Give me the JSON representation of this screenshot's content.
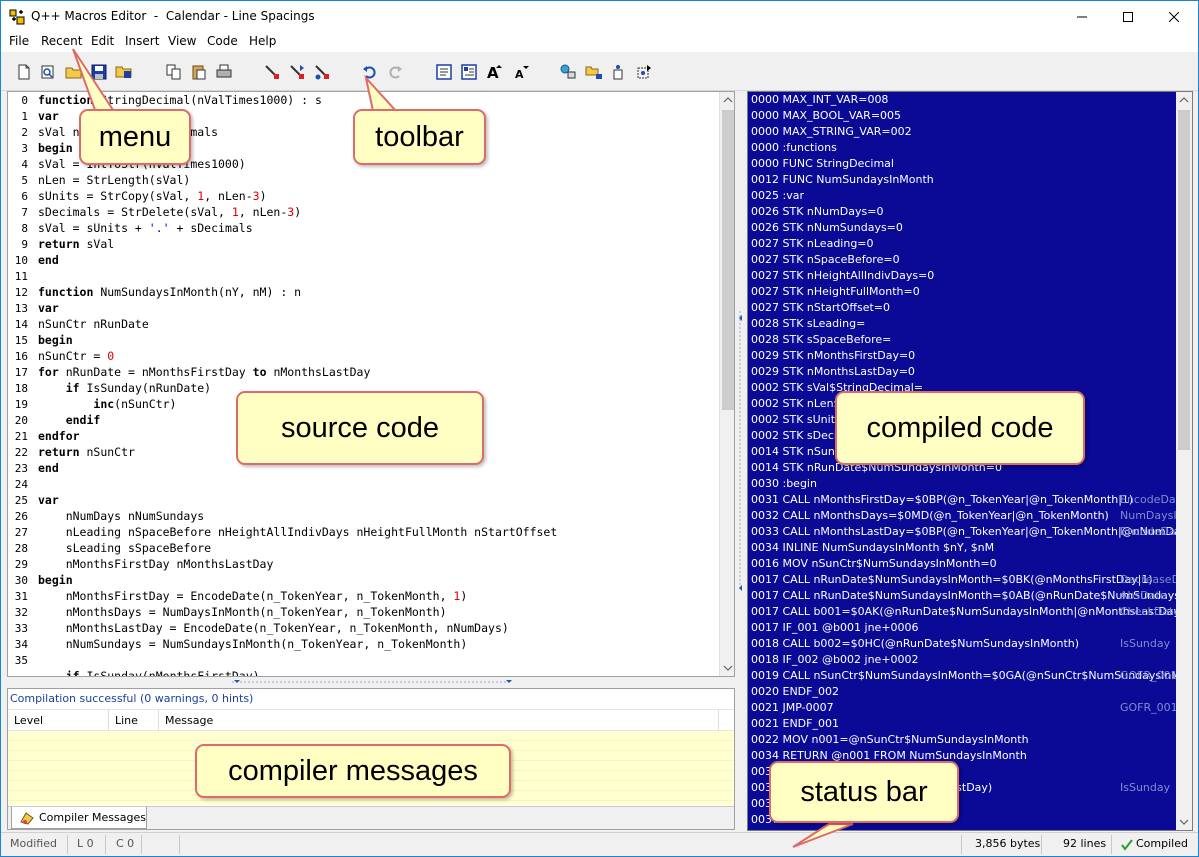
{
  "window": {
    "title": "Q++ Macros Editor  -  Calendar - Line Spacings"
  },
  "menu": [
    "File",
    "Recent",
    "Edit",
    "Insert",
    "View",
    "Code",
    "Help"
  ],
  "source": {
    "line_numbers": [
      "0",
      "1",
      "2",
      "3",
      "4",
      "5",
      "6",
      "7",
      "8",
      "9",
      "10",
      "11",
      "12",
      "13",
      "14",
      "15",
      "16",
      "17",
      "18",
      "19",
      "20",
      "21",
      "22",
      "23",
      "24",
      "25",
      "26",
      "27",
      "28",
      "29",
      "30",
      "31",
      "32",
      "33",
      "34",
      "35"
    ],
    "lines": [
      "function StringDecimal(nValTimes1000) : s",
      "var",
      "sVal nLen sUnits sDecimals",
      "begin",
      "sVal = IntToStr(nValTimes1000)",
      "nLen = StrLength(sVal)",
      "sUnits = StrCopy(sVal, 1, nLen-3)",
      "sDecimals = StrDelete(sVal, 1, nLen-3)",
      "sVal = sUnits + '.' + sDecimals",
      "return sVal",
      "end",
      "",
      "function NumSundaysInMonth(nY, nM) : n",
      "var",
      "nSunCtr nRunDate",
      "begin",
      "nSunCtr = 0",
      "for nRunDate = nMonthsFirstDay to nMonthsLastDay",
      "    if IsSunday(nRunDate)",
      "        inc(nSunCtr)",
      "    endif",
      "endfor",
      "return nSunCtr",
      "end",
      "",
      "var",
      "    nNumDays nNumSundays",
      "    nLeading nSpaceBefore nHeightAllIndivDays nHeightFullMonth nStartOffset",
      "    sLeading sSpaceBefore",
      "    nMonthsFirstDay nMonthsLastDay",
      "begin",
      "    nMonthsFirstDay = EncodeDate(n_TokenYear, n_TokenMonth, 1)",
      "    nMonthsDays = NumDaysInMonth(n_TokenYear, n_TokenMonth)",
      "    nMonthsLastDay = EncodeDate(n_TokenYear, n_TokenMonth, nNumDays)",
      "    nNumSundays = NumSundaysInMonth(n_TokenYear, n_TokenMonth)",
      "",
      "    if IsSunday(nMonthsFirstDay)"
    ]
  },
  "messages": {
    "status": "Compilation successful  (0 warnings, 0 hints)",
    "columns": [
      "Level",
      "Line",
      "Message"
    ],
    "tab": "Compiler Messages"
  },
  "compiled": {
    "lines": [
      "0000 MAX_INT_VAR=008",
      "0000 MAX_BOOL_VAR=005",
      "0000 MAX_STRING_VAR=002",
      "0000 :functions",
      "0000 FUNC StringDecimal",
      "0012 FUNC NumSundaysInMonth",
      "0025 :var",
      "0026 STK nNumDays=0",
      "0026 STK nNumSundays=0",
      "0027 STK nLeading=0",
      "0027 STK nSpaceBefore=0",
      "0027 STK nHeightAllIndivDays=0",
      "0027 STK nHeightFullMonth=0",
      "0027 STK nStartOffset=0",
      "0028 STK sLeading=",
      "0028 STK sSpaceBefore=",
      "0029 STK nMonthsFirstDay=0",
      "0029 STK nMonthsLastDay=0",
      "0002 STK sVal$StringDecimal=",
      "0002 STK nLen$StringDecimal=0",
      "0002 STK sUnits$StringDecimal=",
      "0002 STK sDecimals$StringDecimal=",
      "0014 STK nSunCtr$NumSundaysInMonth=0",
      "0014 STK nRunDate$NumSundaysInMonth=0",
      "0030 :begin",
      "0031 CALL nMonthsFirstDay=$0BP(@n_TokenYear|@n_TokenMonth|1)",
      "0032 CALL nMonthsDays=$0MD(@n_TokenYear|@n_TokenMonth)",
      "0033 CALL nMonthsLastDay=$0BP(@n_TokenYear|@n_TokenMonth|@nNumDays)",
      "0034 INLINE NumSundaysInMonth $nY, $nM",
      "0016 MOV nSunCtr$NumSundaysInMonth=0",
      "0017 CALL nRunDate$NumSundaysInMonth=$0BK(@nMonthsFirstDay|1)",
      "0017 CALL nRunDate$NumSundaysInMonth=$0AB(@nRunDate$NumSundaysInMonth)",
      "0017 CALL b001=$0AK(@nRunDate$NumSundaysInMonth|@nMonthsLastDay|1)",
      "0017 IF_001 @b001 jne+0006",
      "0018 CALL b002=$0HC(@nRunDate$NumSundaysInMonth)",
      "0018 IF_002 @b002 jne+0002",
      "0019 CALL nSunCtr$NumSundaysInMonth=$0GA(@nSunCtr$NumSundaysInMonth)",
      "0020 ENDF_002",
      "0021 JMP-0007",
      "0021 ENDF_001",
      "0022 MOV n001=@nSunCtr$NumSundaysInMonth",
      "0034 RETURN @n001 FROM NumSundaysInMonth",
      "0034 MOV nNumSundays=@n001",
      "0036 CALL b003=$0HC(@nMonthsFirstDay)",
      "0036 IF_003 @b003 jne+0002",
      "0037 MOV nHeightFullMonth=314"
    ],
    "comments": [
      {
        "line": 25,
        "text": "EncodeDate"
      },
      {
        "line": 26,
        "text": "NumDaysInMonth"
      },
      {
        "line": 27,
        "text": "EncodeDate"
      },
      {
        "line": 30,
        "text": "DecreaseDate"
      },
      {
        "line": 31,
        "text": "AbsDate"
      },
      {
        "line": 32,
        "text": "CheckDate"
      },
      {
        "line": 34,
        "text": "IsSunday"
      },
      {
        "line": 36,
        "text": "GOFR_001"
      },
      {
        "line": 38,
        "text": "GOFR_001"
      },
      {
        "line": 43,
        "text": "IsSunday"
      }
    ]
  },
  "status_bar": {
    "mode": "Modified",
    "line": "L 0",
    "col": "C 0",
    "size": "3,856 bytes",
    "lines": "92 lines",
    "state": "Compiled"
  },
  "callouts": {
    "menu": "menu",
    "toolbar": "toolbar",
    "source": "source code",
    "compiled": "compiled code",
    "messages": "compiler messages",
    "status": "status bar"
  },
  "colors": {
    "compiled_bg": "#0a0a96",
    "callout_bg": "#ffffc4",
    "callout_border": "#e06a6a",
    "status_ok": "#2a9d2a"
  }
}
